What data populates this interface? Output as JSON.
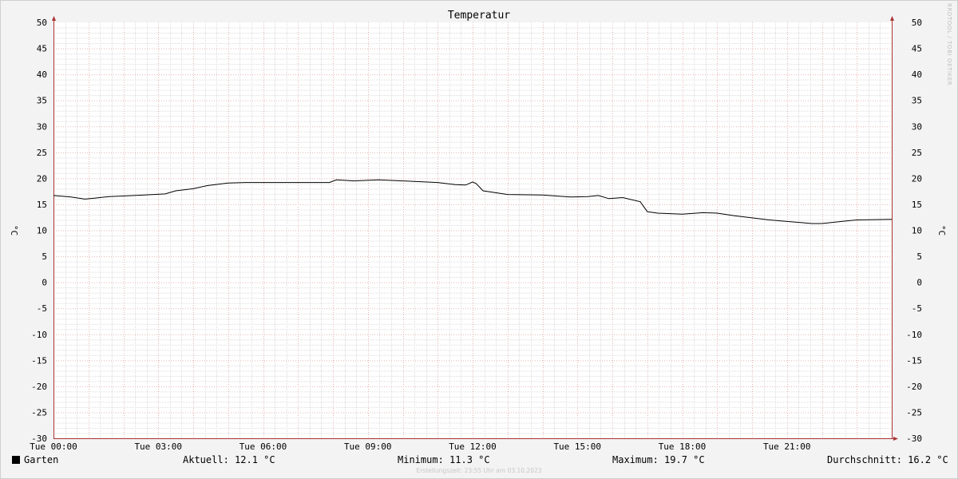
{
  "chart_data": {
    "type": "line",
    "title": "Temperatur",
    "ylabel": "°C",
    "ylim": [
      -30,
      50
    ],
    "y_ticks": [
      "50",
      "45",
      "40",
      "35",
      "30",
      "25",
      "20",
      "15",
      "10",
      "5",
      "0",
      "-5",
      "-10",
      "-15",
      "-20",
      "-25",
      "-30"
    ],
    "x_ticks": [
      "Tue 00:00",
      "Tue 03:00",
      "Tue 06:00",
      "Tue 09:00",
      "Tue 12:00",
      "Tue 15:00",
      "Tue 18:00",
      "Tue 21:00"
    ],
    "grid": true,
    "series": [
      {
        "name": "Garten",
        "color": "#000000",
        "x_hours": [
          0,
          0.5,
          0.9,
          1.2,
          1.6,
          2.0,
          2.6,
          3.2,
          3.5,
          4.0,
          4.4,
          5.0,
          5.5,
          6.0,
          7.0,
          7.9,
          8.1,
          8.6,
          9.3,
          10.0,
          11.0,
          11.5,
          11.8,
          12.0,
          12.1,
          12.3,
          13.0,
          14.0,
          14.8,
          15.3,
          15.6,
          15.9,
          16.3,
          16.8,
          17.0,
          17.3,
          18.0,
          18.6,
          19.0,
          19.5,
          20.0,
          20.5,
          21.0,
          21.4,
          21.7,
          22.0,
          22.7,
          23.0,
          24.0
        ],
        "values": [
          16.7,
          16.4,
          16.0,
          16.2,
          16.5,
          16.6,
          16.8,
          17.0,
          17.6,
          18.0,
          18.6,
          19.1,
          19.2,
          19.2,
          19.2,
          19.2,
          19.7,
          19.5,
          19.7,
          19.5,
          19.2,
          18.8,
          18.7,
          19.3,
          19.0,
          17.6,
          16.9,
          16.8,
          16.4,
          16.5,
          16.7,
          16.1,
          16.3,
          15.5,
          13.6,
          13.3,
          13.1,
          13.4,
          13.3,
          12.8,
          12.4,
          12.0,
          11.7,
          11.5,
          11.3,
          11.3,
          11.8,
          12.0,
          12.1
        ]
      }
    ]
  },
  "legend": {
    "series_name": "Garten",
    "current": "Aktuell: 12.1 °C",
    "minimum": "Minimum: 11.3 °C",
    "maximum": "Maximum: 19.7 °C",
    "average": "Durchschnitt: 16.2 °C"
  },
  "footer": "Erstellungszeit: 23:55 Uhr am 03.10.2023",
  "watermark": "RRDTOOL / TOBI OETIKER"
}
